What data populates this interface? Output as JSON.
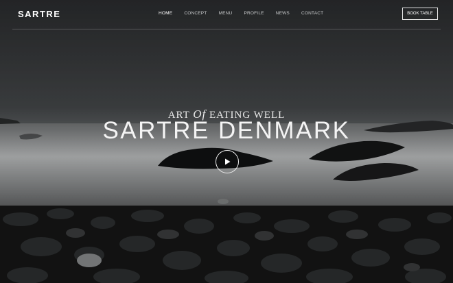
{
  "brand": {
    "logo": "SARTRE"
  },
  "nav": {
    "items": [
      "HOME",
      "CONCEPT",
      "MENU",
      "PROFILE",
      "NEWS",
      "CONTACT"
    ],
    "active": "HOME"
  },
  "header": {
    "cta": "BOOK TABLE"
  },
  "hero": {
    "eyebrow_prefix": "ART",
    "eyebrow_mid": "Of",
    "eyebrow_suffix": "EATING WELL",
    "title": "SARTRE DENMARK",
    "play_icon": "play-icon"
  },
  "colors": {
    "text": "#ffffff",
    "overlay": "#1d1f21"
  }
}
